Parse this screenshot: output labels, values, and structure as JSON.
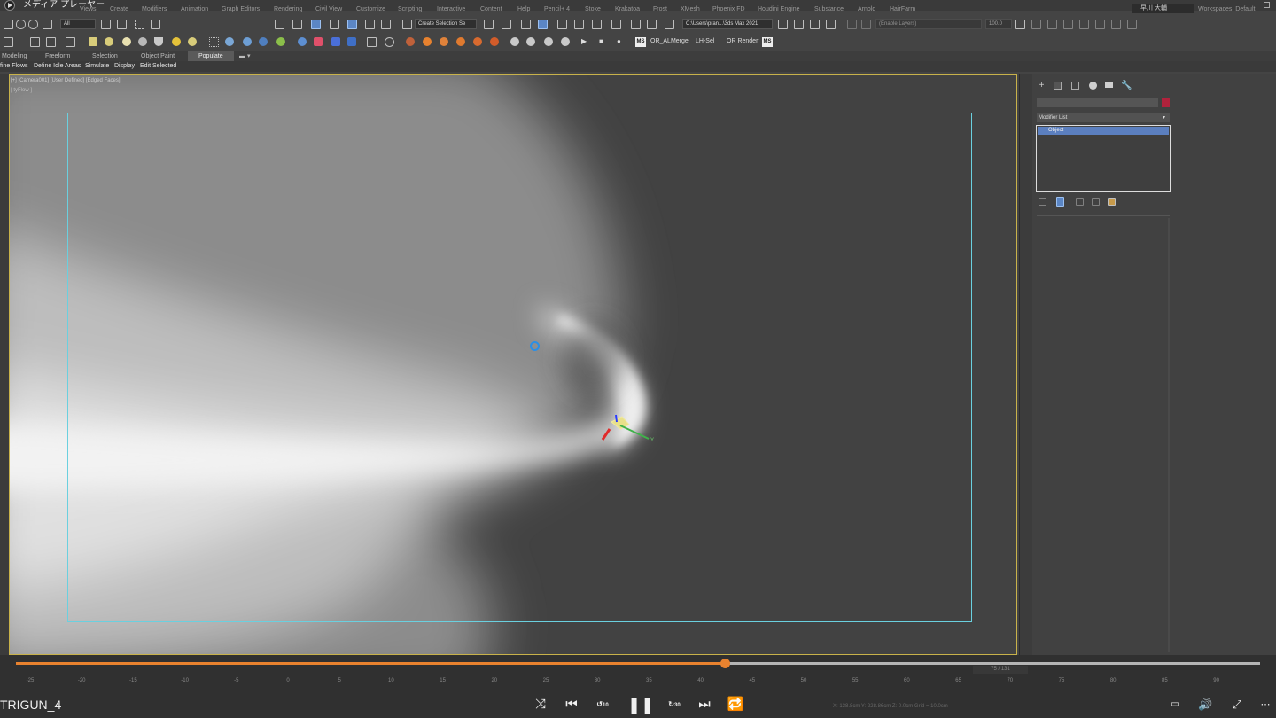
{
  "window": {
    "title": "メディア プレーヤー",
    "user": "早川 大輔",
    "workspaces": "Workspaces: Default"
  },
  "menu": [
    "Views",
    "Create",
    "Modifiers",
    "Animation",
    "Graph Editors",
    "Rendering",
    "Civil View",
    "Customize",
    "Scripting",
    "Interactive",
    "Content",
    "Help",
    "Pencil+ 4",
    "Stoke",
    "Krakatoa",
    "Frost",
    "XMesh",
    "Phoenix FD",
    "Houdini Engine",
    "Substance",
    "Arnold",
    "HairFarm"
  ],
  "toolbar": {
    "filter_dropdown": "All",
    "selection_set": "Create Selection Se",
    "path_dropdown": "C:\\Users\\pran...\\3ds Max 2021",
    "layers_dropdown": "(Enable Layers)",
    "zoom_value": "100.0",
    "or_almerge": "OR_ALMerge",
    "lh_sel": "LH-Sel",
    "or_render": "OR Render",
    "ms_badge": "MS"
  },
  "ribbon": {
    "tabs": [
      "Modeling",
      "Freeform",
      "Selection",
      "Object Paint",
      "Populate"
    ],
    "active_tab": "Populate",
    "sub_items": [
      "fine Flows",
      "Define Idle Areas",
      "Simulate",
      "Display",
      "Edit Selected"
    ]
  },
  "viewport": {
    "label": "[+] [Camera001] [User Defined] [Edged Faces]",
    "sublabel": "[ tyFlow ]"
  },
  "command_panel": {
    "modifier_list": "Modifier List",
    "stack_item": "Object",
    "swatch_color": "#b0223c"
  },
  "player": {
    "progress": 0.57,
    "frame_counter": "75 / 131",
    "video_title": "TRIGUN_4",
    "ruler_ticks": [
      "-25",
      "-20",
      "-15",
      "-10",
      "-5",
      "0",
      "5",
      "10",
      "15",
      "20",
      "25",
      "30",
      "35",
      "40",
      "45",
      "50",
      "55",
      "60",
      "65",
      "70",
      "75",
      "80",
      "85",
      "90"
    ],
    "skip_back_label": "10",
    "skip_forward_label": "30",
    "status_text": "X: 138.8cm   Y: 228.86cm   Z: 0.0cm      Grid = 10.0cm",
    "accent_color": "#e8822f"
  }
}
